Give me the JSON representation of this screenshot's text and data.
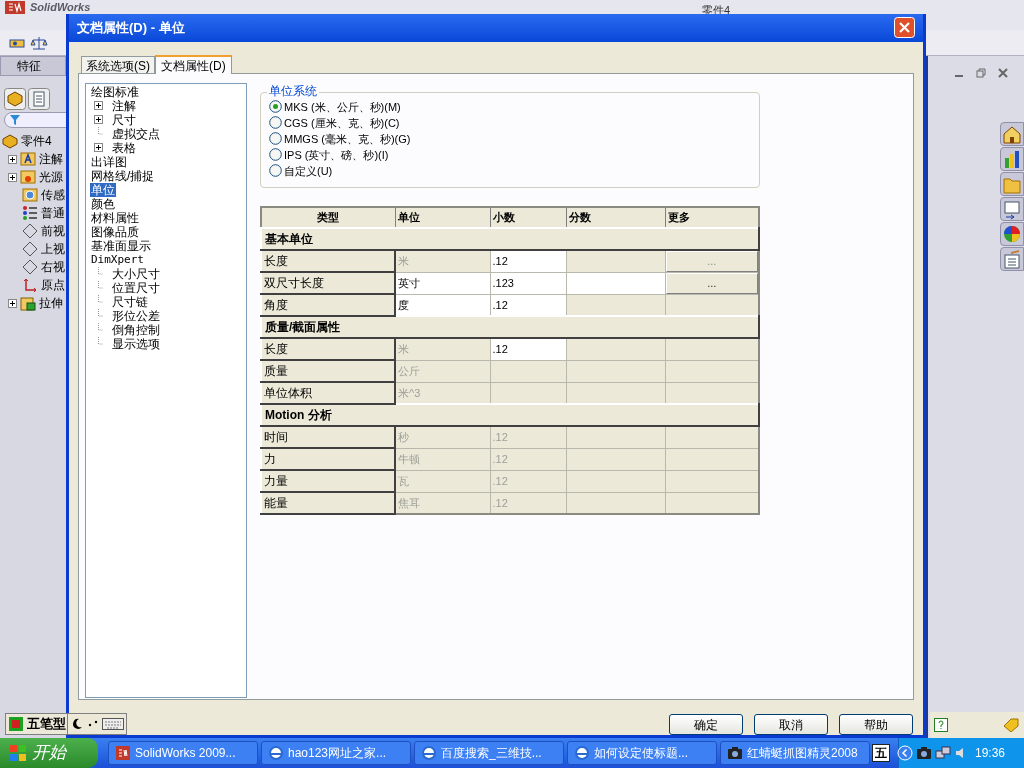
{
  "app": {
    "logo": "SolidWorks",
    "document_title": "零件4",
    "feature_manager": {
      "tab": "特征",
      "tree": [
        {
          "label": "零件4",
          "kind": "part"
        },
        {
          "label": "注解",
          "kind": "annotation",
          "expanded": false
        },
        {
          "label": "光源",
          "kind": "light",
          "expanded": false
        },
        {
          "label": "传感",
          "kind": "sensor"
        },
        {
          "label": "普通",
          "kind": "material"
        },
        {
          "label": "前视",
          "kind": "plane"
        },
        {
          "label": "上视",
          "kind": "plane"
        },
        {
          "label": "右视",
          "kind": "plane"
        },
        {
          "label": "原点",
          "kind": "origin"
        },
        {
          "label": "拉伸",
          "kind": "extrude",
          "expanded": false
        }
      ]
    }
  },
  "dialog": {
    "title": "文档属性(D) - 单位",
    "tabs": [
      {
        "label": "系统选项(S)",
        "selected": false
      },
      {
        "label": "文档属性(D)",
        "selected": true
      }
    ],
    "settings_tree": [
      {
        "label": "绘图标准",
        "selected": false,
        "children": [
          {
            "label": "注解",
            "selected": false,
            "expanded": false
          },
          {
            "label": "尺寸",
            "selected": false,
            "expanded": false
          },
          {
            "label": "虚拟交点",
            "selected": false
          },
          {
            "label": "表格",
            "selected": false,
            "expanded": false
          }
        ]
      },
      {
        "label": "出详图",
        "selected": false
      },
      {
        "label": "网格线/捕捉",
        "selected": false
      },
      {
        "label": "单位",
        "selected": true
      },
      {
        "label": "颜色",
        "selected": false
      },
      {
        "label": "材料属性",
        "selected": false
      },
      {
        "label": "图像品质",
        "selected": false
      },
      {
        "label": "基准面显示",
        "selected": false
      },
      {
        "label": "DimXpert",
        "selected": false,
        "children": [
          {
            "label": "大小尺寸",
            "selected": false
          },
          {
            "label": "位置尺寸",
            "selected": false
          },
          {
            "label": "尺寸链",
            "selected": false
          },
          {
            "label": "形位公差",
            "selected": false
          },
          {
            "label": "倒角控制",
            "selected": false
          },
          {
            "label": "显示选项",
            "selected": false
          }
        ]
      }
    ],
    "unit_system": {
      "title": "单位系统",
      "options": [
        {
          "label": "MKS (米、公斤、秒)(M)",
          "selected": true
        },
        {
          "label": "CGS (厘米、克、秒)(C)",
          "selected": false
        },
        {
          "label": "MMGS (毫米、克、秒)(G)",
          "selected": false
        },
        {
          "label": "IPS (英寸、磅、秒)(I)",
          "selected": false
        },
        {
          "label": "自定义(U)",
          "selected": false
        }
      ]
    },
    "table": {
      "columns": [
        "类型",
        "单位",
        "小数",
        "分数",
        "更多"
      ],
      "rows": [
        {
          "kind": "section",
          "label": "基本单位"
        },
        {
          "kind": "unit",
          "type": "长度",
          "unit": {
            "text": "米",
            "editable": false
          },
          "decimal": {
            "text": ".12",
            "editable": true
          },
          "more": {
            "label": "...",
            "disabled": true
          }
        },
        {
          "kind": "unit",
          "type": "双尺寸长度",
          "unit": {
            "text": "英寸",
            "editable": true
          },
          "decimal": {
            "text": ".123",
            "editable": true
          },
          "fraction": {
            "editable": true
          },
          "more": {
            "label": "...",
            "disabled": false
          }
        },
        {
          "kind": "unit",
          "type": "角度",
          "unit": {
            "text": "度",
            "editable": true
          },
          "decimal": {
            "text": ".12",
            "editable": true
          }
        },
        {
          "kind": "section",
          "label": "质量/截面属性"
        },
        {
          "kind": "unit",
          "type": "长度",
          "unit": {
            "text": "米",
            "editable": false
          },
          "decimal": {
            "text": ".12",
            "editable": true
          }
        },
        {
          "kind": "unit",
          "type": "质量",
          "unit": {
            "text": "公斤",
            "editable": false
          }
        },
        {
          "kind": "unit",
          "type": "单位体积",
          "unit": {
            "text": "米^3",
            "editable": false
          }
        },
        {
          "kind": "section",
          "label": "Motion 分析"
        },
        {
          "kind": "unit",
          "type": "时间",
          "unit": {
            "text": "秒",
            "editable": false
          },
          "decimal": {
            "text": ".12",
            "editable": false
          }
        },
        {
          "kind": "unit",
          "type": "力",
          "unit": {
            "text": "牛顿",
            "editable": false
          },
          "decimal": {
            "text": ".12",
            "editable": false
          }
        },
        {
          "kind": "unit",
          "type": "力量",
          "unit": {
            "text": "瓦",
            "editable": false
          },
          "decimal": {
            "text": ".12",
            "editable": false
          }
        },
        {
          "kind": "unit",
          "type": "能量",
          "unit": {
            "text": "焦耳",
            "editable": false
          },
          "decimal": {
            "text": ".12",
            "editable": false
          }
        }
      ]
    },
    "buttons": [
      "确定",
      "取消",
      "帮助"
    ]
  },
  "ime_bar": {
    "label": "五笔型"
  },
  "taskbar": {
    "start": "开始",
    "tasks": [
      {
        "label": "SolidWorks 2009...",
        "kind": "sw"
      },
      {
        "label": "hao123网址之家...",
        "kind": "ie"
      },
      {
        "label": "百度搜索_三维技...",
        "kind": "ie"
      },
      {
        "label": "如何设定使标题...",
        "kind": "ie"
      },
      {
        "label": "红蜻蜓抓图精灵2008",
        "kind": "camera"
      }
    ],
    "ime": "五",
    "clock": "19:36"
  }
}
